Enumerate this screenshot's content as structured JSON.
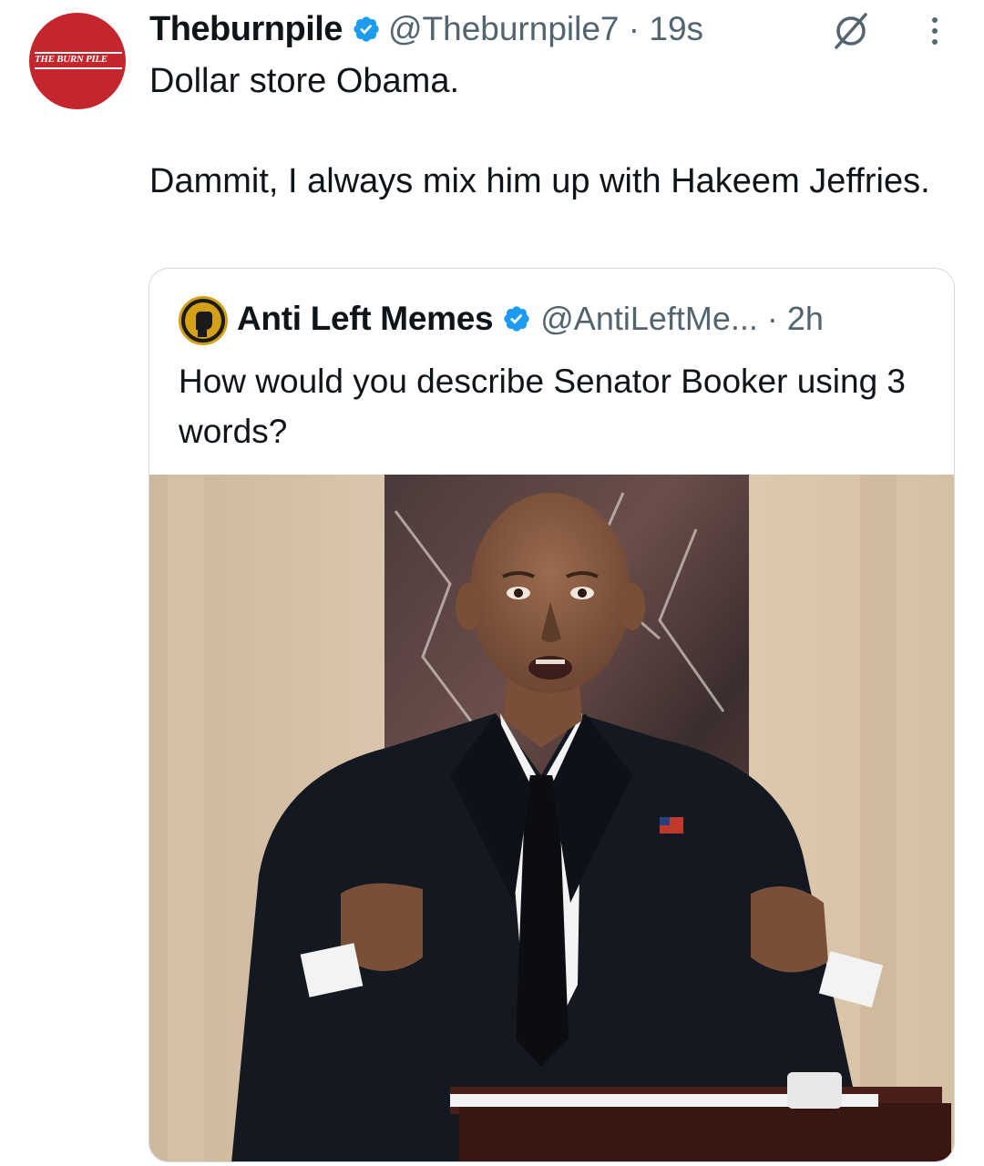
{
  "tweet": {
    "avatar_text": "THE BURN PILE",
    "display_name": "Theburnpile",
    "handle_time": "@Theburnpile7 · 19s",
    "body_line1": "Dollar store Obama.",
    "body_line2": "Dammit, I always mix him up with Hakeem Jeffries."
  },
  "quote": {
    "display_name": "Anti Left Memes",
    "handle_time": "@AntiLeftMe... · 2h",
    "body": "How would you describe Senator Booker using 3 words?"
  },
  "icons": {
    "verified": "verified-badge-icon",
    "grok": "grok-icon",
    "more": "more-vertical-icon"
  },
  "colors": {
    "verified_blue": "#1d9bf0",
    "avatar_red": "#c4262e",
    "text_primary": "#0f1419",
    "text_secondary": "#536471",
    "border": "#cfd9de"
  }
}
